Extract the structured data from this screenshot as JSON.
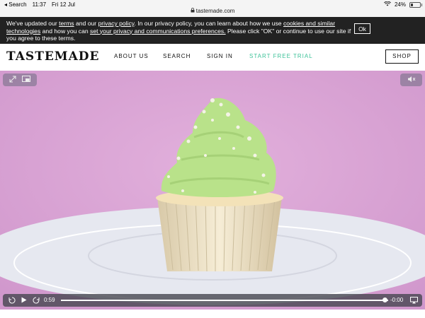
{
  "status_bar": {
    "back_label": "◂ Search",
    "time": "11:37",
    "date": "Fri 12 Jul",
    "url": "tastemade.com",
    "battery": "24%",
    "battery_level": 0.24
  },
  "cookie_banner": {
    "t1": "We've updated our ",
    "l1": "terms",
    "t2": " and our ",
    "l2": "privacy policy",
    "t3": ". In our privacy policy, you can learn about how we use ",
    "l3": "cookies and similar technologies",
    "t4": " and how you can ",
    "l4": "set your privacy and communications preferences.",
    "t5": " Please click \"OK\" or continue to use our site if you agree to these terms.",
    "ok_label": "Ok"
  },
  "header": {
    "logo": "TASTEMADE",
    "nav": [
      "ABOUT US",
      "SEARCH",
      "SIGN IN",
      "START FREE TRIAL"
    ],
    "shop_label": "SHOP",
    "trial_color": "#3fc39a"
  },
  "video": {
    "current_time": "0:59",
    "remaining_time": "-0:00",
    "progress": 0.99
  }
}
